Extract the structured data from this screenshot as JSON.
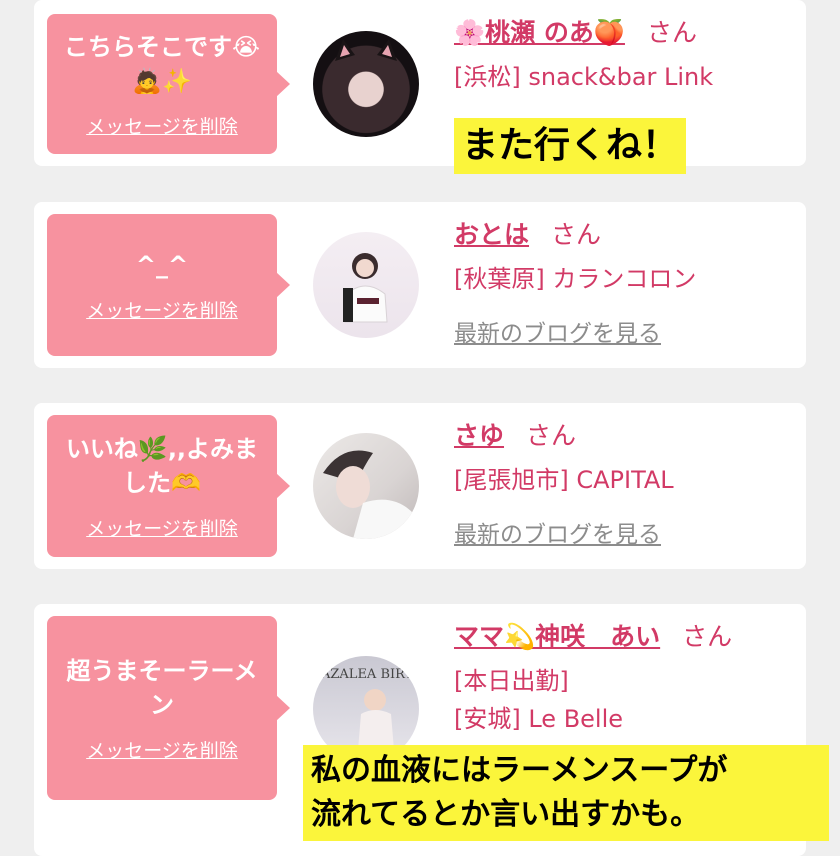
{
  "cards": [
    {
      "message": "こちらそこです😭🙇✨",
      "delete_label": "メッセージを削除",
      "name": "🌸桃瀬 のあ🍑",
      "honorific": "さん",
      "shop": "[浜松] snack&bar Link",
      "blog_label": ""
    },
    {
      "message": "^_^",
      "delete_label": "メッセージを削除",
      "name": "おとは",
      "honorific": "さん",
      "shop": "[秋葉原] カランコロン",
      "blog_label": "最新のブログを見る"
    },
    {
      "message": "いいね🌿,,よみました🫶",
      "delete_label": "メッセージを削除",
      "name": "さゆ",
      "honorific": "さん",
      "shop": "[尾張旭市] CAPITAL",
      "blog_label": "最新のブログを見る"
    },
    {
      "message": "超うまそーラーメン",
      "delete_label": "メッセージを削除",
      "name": "ママ💫神咲　あい",
      "honorific": "さん",
      "status": "[本日出勤]",
      "shop": "[安城] Le Belle",
      "poster_text": "AZALEA BIRTHDAY"
    }
  ],
  "captions": {
    "first": "また行くね！",
    "bottom_line1": "私の血液にはラーメンスープが",
    "bottom_line2": "流れてるとか言い出すかも。"
  },
  "colors": {
    "bubble": "#f7929f",
    "name": "#d23a66",
    "caption_bg": "#fbf53b"
  }
}
